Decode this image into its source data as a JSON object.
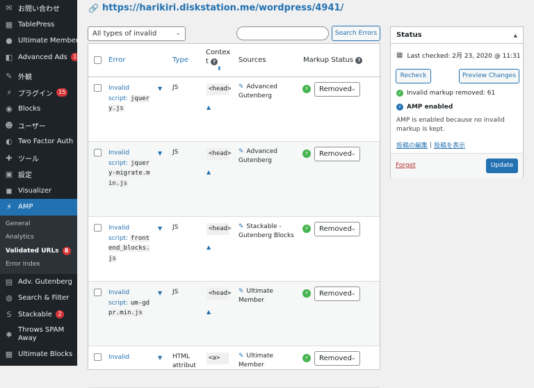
{
  "sidebar": {
    "items": [
      {
        "icon": "mail-icon",
        "glyph": "✉",
        "label": "お問い合わせ"
      },
      {
        "icon": "table-icon",
        "glyph": "▦",
        "label": "TablePress"
      },
      {
        "icon": "user-icon",
        "glyph": "●",
        "label": "Ultimate Member"
      },
      {
        "icon": "ads-icon",
        "glyph": "◧",
        "label": "Advanced Ads",
        "badge": "1"
      },
      {
        "icon": "brush-icon",
        "glyph": "✎",
        "label": "外観"
      },
      {
        "icon": "plugin-icon",
        "glyph": "⚡",
        "label": "プラグイン",
        "badge": "15"
      },
      {
        "icon": "blocks-icon",
        "glyph": "◉",
        "label": "Blocks"
      },
      {
        "icon": "users-icon",
        "glyph": "☻",
        "label": "ユーザー"
      },
      {
        "icon": "shield-icon",
        "glyph": "◐",
        "label": "Two Factor Auth"
      },
      {
        "icon": "tools-icon",
        "glyph": "✚",
        "label": "ツール"
      },
      {
        "icon": "settings-icon",
        "glyph": "▣",
        "label": "設定"
      },
      {
        "icon": "visualizer-icon",
        "glyph": "◼",
        "label": "Visualizer"
      },
      {
        "icon": "amp-icon",
        "glyph": "⚡",
        "label": "AMP"
      }
    ],
    "amp_sub": [
      "General",
      "Analytics",
      "Validated URLs",
      "Error Index"
    ],
    "validated_badge": "8",
    "bottom_items": [
      {
        "icon": "gutenberg-icon",
        "glyph": "▤",
        "label": "Adv. Gutenberg"
      },
      {
        "icon": "search-filter-icon",
        "glyph": "◍",
        "label": "Search & Filter"
      },
      {
        "icon": "stackable-icon",
        "glyph": "S",
        "label": "Stackable",
        "badge": "2"
      },
      {
        "icon": "gear-icon",
        "glyph": "✱",
        "label": "Throws SPAM Away"
      },
      {
        "icon": "ultimate-blocks-icon",
        "glyph": "▦",
        "label": "Ultimate Blocks"
      }
    ]
  },
  "header": {
    "url": "https://harikiri.diskstation.me/wordpress/4941/"
  },
  "filter": {
    "selected": "All types of invalid markup"
  },
  "search": {
    "button": "Search Errors",
    "value": ""
  },
  "table": {
    "headers": {
      "error": "Error",
      "type": "Type",
      "context": "Context",
      "sources": "Sources",
      "markup_status": "Markup Status"
    },
    "rows": [
      {
        "error_label": "Invalid script:",
        "code": "jquery.js",
        "type": "JS",
        "context": "<head>",
        "source": "Advanced Gutenberg",
        "status": "Removed"
      },
      {
        "error_label": "Invalid script:",
        "code": "jquery-migrate.min.js",
        "type": "JS",
        "context": "<head>",
        "source": "Advanced Gutenberg",
        "status": "Removed"
      },
      {
        "error_label": "Invalid script:",
        "code": "frontend_blocks.js",
        "type": "JS",
        "context": "<head>",
        "source": "Stackable - Gutenberg Blocks",
        "status": "Removed"
      },
      {
        "error_label": "Invalid script:",
        "code": "um-gdpr.min.js",
        "type": "JS",
        "context": "<head>",
        "source": "Ultimate Member",
        "status": "Removed"
      },
      {
        "error_label": "Invalid",
        "code": "",
        "type": "HTML attribut",
        "context": "<a>",
        "source": "Ultimate Member",
        "status": "Removed"
      }
    ]
  },
  "status_box": {
    "title": "Status",
    "last_checked": "Last checked: 2月 23, 2020 @ 11:31",
    "recheck": "Recheck",
    "preview": "Preview Changes",
    "removed": "Invalid markup removed: 61",
    "amp_enabled": "AMP enabled",
    "description": "AMP is enabled because no invalid markup is kept.",
    "edit_link": "投稿の編集",
    "view_link": "投稿を表示",
    "forget": "Forget",
    "update": "Update"
  },
  "colors": {
    "accent": "#2271b1",
    "sidebar": "#1d2327",
    "success": "#46b450",
    "badge": "#d63638"
  }
}
